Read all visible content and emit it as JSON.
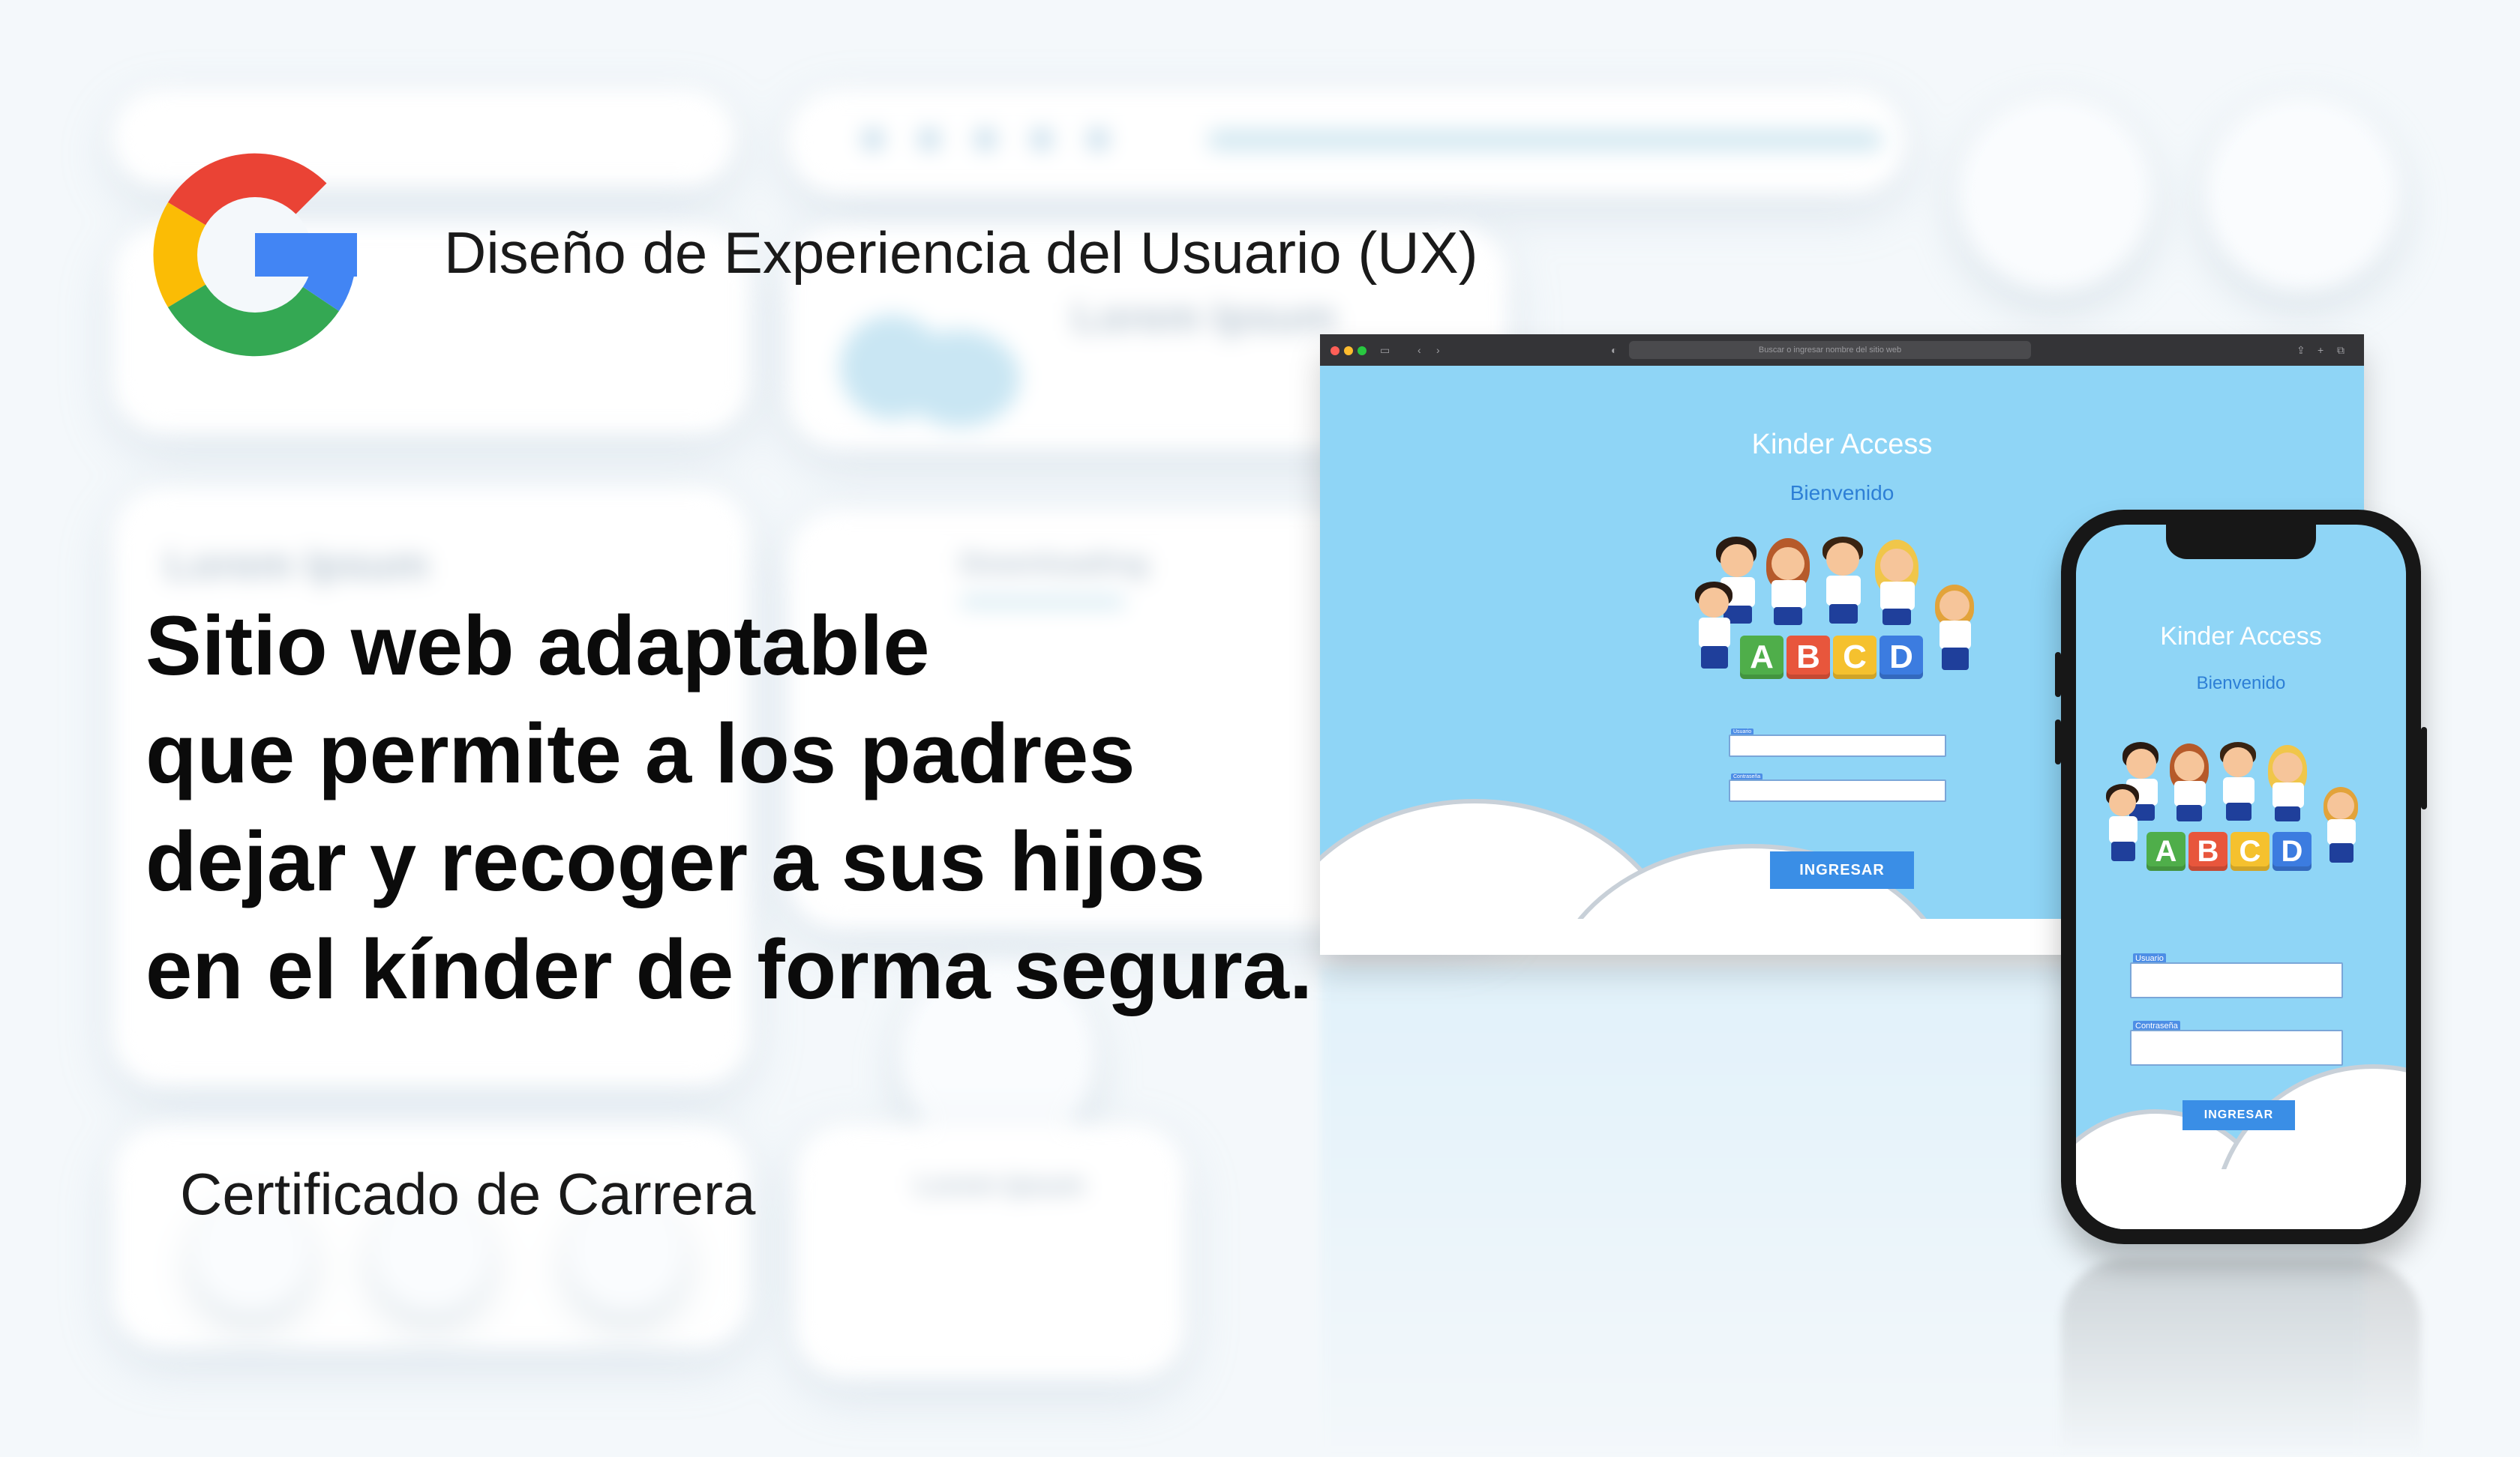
{
  "header": {
    "logo": "google-g-logo",
    "course_title": "Diseño de Experiencia del Usuario (UX)"
  },
  "headline": {
    "lines": [
      "Sitio web adaptable",
      "que permite a los padres",
      "dejar y recoger a sus hijos",
      "en el kínder de forma segura."
    ]
  },
  "footer": {
    "certificate": "Certificado de Carrera"
  },
  "desktop_mock": {
    "address_bar": "Buscar o ingresar nombre del sitio web",
    "app_title": "Kinder Access",
    "welcome": "Bienvenido",
    "user_label": "Usuario",
    "password_label": "Contraseña",
    "login_button": "INGRESAR"
  },
  "mobile_mock": {
    "app_title": "Kinder Access",
    "welcome": "Bienvenido",
    "user_label": "Usuario",
    "password_label": "Contraseña",
    "login_button": "INGRESAR"
  },
  "blocks": [
    "A",
    "B",
    "C",
    "D"
  ],
  "colors": {
    "google_red": "#ea4335",
    "google_yellow": "#fbbc05",
    "google_green": "#34a853",
    "google_blue": "#4285f4",
    "sky": "#8fd5f6",
    "button_blue": "#3a8ee6"
  }
}
